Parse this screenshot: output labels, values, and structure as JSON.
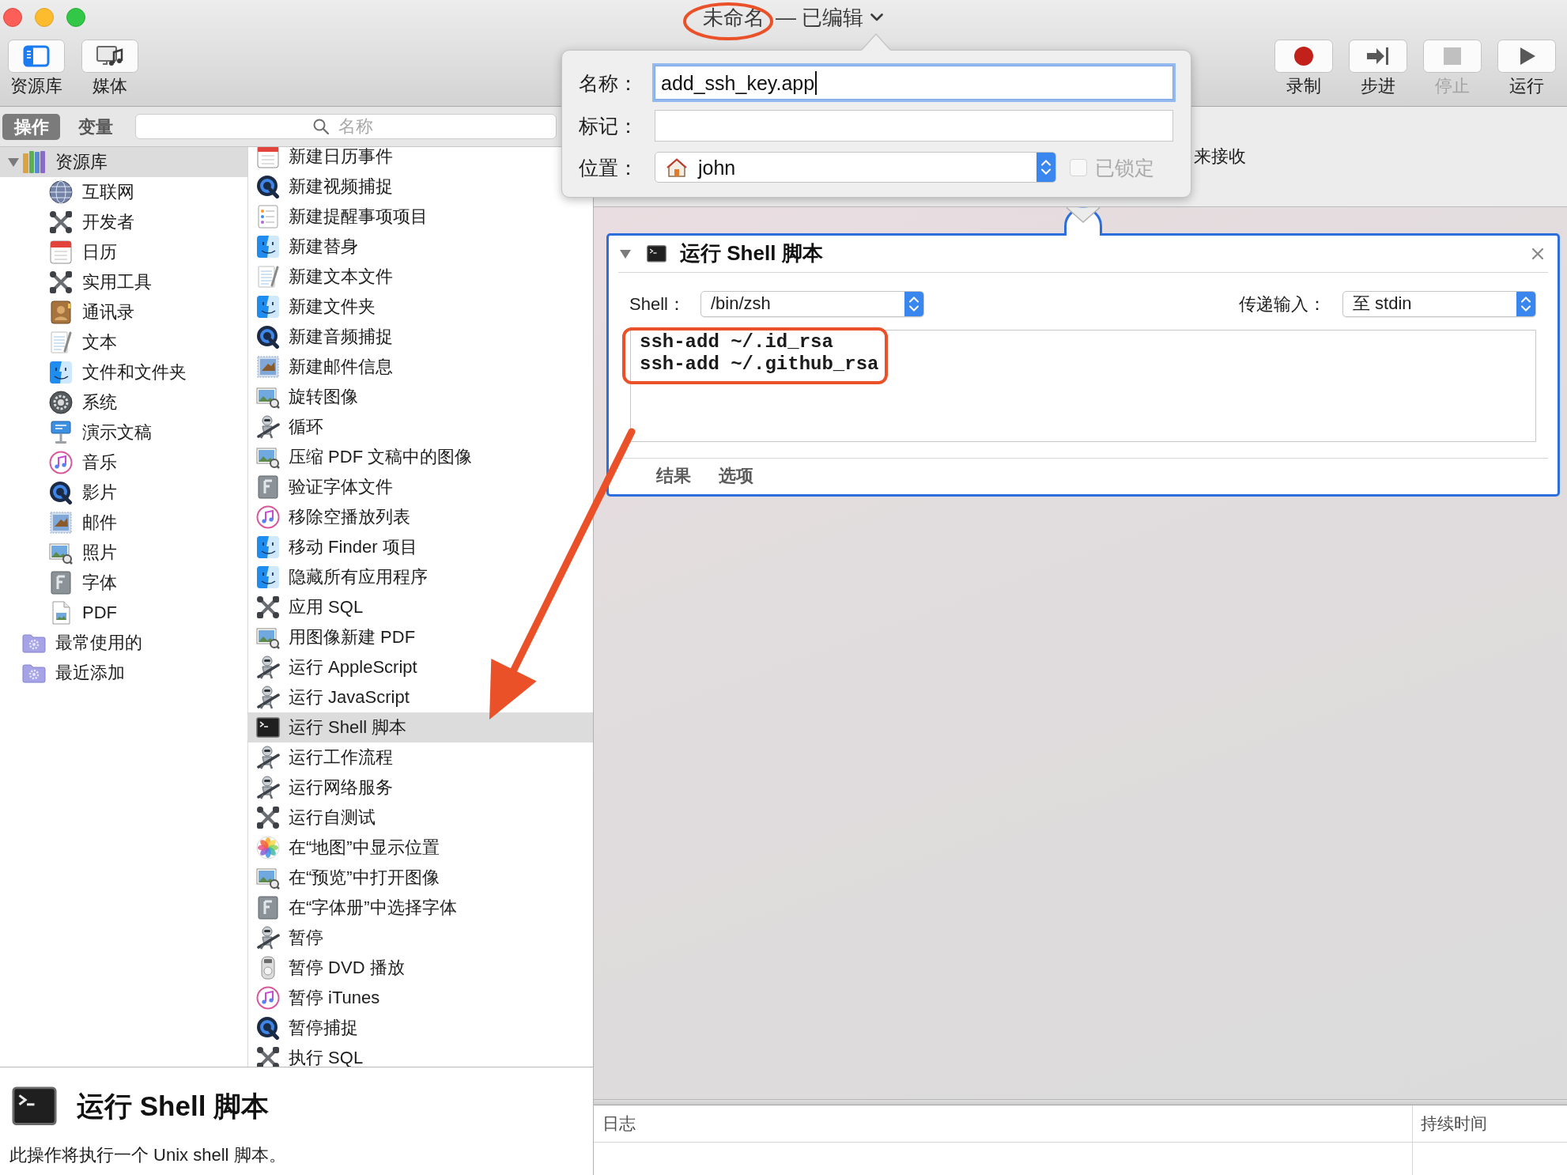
{
  "window": {
    "title": "未命名",
    "status": "— 已编辑"
  },
  "toolbar": {
    "left": [
      {
        "kind": "library",
        "label": "资源库"
      },
      {
        "kind": "media",
        "label": "媒体"
      }
    ],
    "right": [
      {
        "kind": "record",
        "label": "录制",
        "disabled": false
      },
      {
        "kind": "step",
        "label": "步进",
        "disabled": false
      },
      {
        "kind": "stop",
        "label": "停止",
        "disabled": true
      },
      {
        "kind": "run",
        "label": "运行",
        "disabled": false
      }
    ]
  },
  "library_tabs": [
    {
      "label": "操作",
      "selected": true
    },
    {
      "label": "变量",
      "selected": false
    }
  ],
  "search": {
    "placeholder": "名称"
  },
  "library_tree": [
    {
      "kind": "library",
      "label": "资源库",
      "expanded": true,
      "selected": true,
      "children": [
        {
          "kind": "globe",
          "label": "互联网",
          "selected": false
        },
        {
          "kind": "tools",
          "label": "开发者",
          "selected": false
        },
        {
          "kind": "calendar",
          "label": "日历",
          "selected": false
        },
        {
          "kind": "tools",
          "label": "实用工具",
          "selected": false
        },
        {
          "kind": "contacts",
          "label": "通讯录",
          "selected": false
        },
        {
          "kind": "text",
          "label": "文本",
          "selected": false
        },
        {
          "kind": "finder",
          "label": "文件和文件夹",
          "selected": false
        },
        {
          "kind": "system",
          "label": "系统",
          "selected": false
        },
        {
          "kind": "keynote",
          "label": "演示文稿",
          "selected": false
        },
        {
          "kind": "music",
          "label": "音乐",
          "selected": false
        },
        {
          "kind": "quicktime",
          "label": "影片",
          "selected": false
        },
        {
          "kind": "mail",
          "label": "邮件",
          "selected": false
        },
        {
          "kind": "preview",
          "label": "照片",
          "selected": false
        },
        {
          "kind": "font",
          "label": "字体",
          "selected": false
        },
        {
          "kind": "pdf",
          "label": "PDF",
          "selected": false
        }
      ]
    },
    {
      "kind": "smartfolder",
      "label": "最常使用的",
      "selected": false
    },
    {
      "kind": "smartfolder",
      "label": "最近添加",
      "selected": false
    }
  ],
  "actions": [
    {
      "kind": "calendar",
      "label": "新建日历事件",
      "selected": false
    },
    {
      "kind": "quicktime",
      "label": "新建视频捕捉",
      "selected": false
    },
    {
      "kind": "reminders",
      "label": "新建提醒事项项目",
      "selected": false
    },
    {
      "kind": "finder",
      "label": "新建替身",
      "selected": false
    },
    {
      "kind": "text",
      "label": "新建文本文件",
      "selected": false
    },
    {
      "kind": "finder",
      "label": "新建文件夹",
      "selected": false
    },
    {
      "kind": "quicktime",
      "label": "新建音频捕捉",
      "selected": false
    },
    {
      "kind": "mail",
      "label": "新建邮件信息",
      "selected": false
    },
    {
      "kind": "preview",
      "label": "旋转图像",
      "selected": false
    },
    {
      "kind": "robot",
      "label": "循环",
      "selected": false
    },
    {
      "kind": "preview",
      "label": "压缩 PDF 文稿中的图像",
      "selected": false
    },
    {
      "kind": "font",
      "label": "验证字体文件",
      "selected": false
    },
    {
      "kind": "music",
      "label": "移除空播放列表",
      "selected": false
    },
    {
      "kind": "finder",
      "label": "移动 Finder 项目",
      "selected": false
    },
    {
      "kind": "finder",
      "label": "隐藏所有应用程序",
      "selected": false
    },
    {
      "kind": "tools",
      "label": "应用 SQL",
      "selected": false
    },
    {
      "kind": "preview",
      "label": "用图像新建 PDF",
      "selected": false
    },
    {
      "kind": "robot",
      "label": "运行 AppleScript",
      "selected": false
    },
    {
      "kind": "robot",
      "label": "运行 JavaScript",
      "selected": false
    },
    {
      "kind": "terminal",
      "label": "运行 Shell 脚本",
      "selected": true
    },
    {
      "kind": "robot",
      "label": "运行工作流程",
      "selected": false
    },
    {
      "kind": "robot",
      "label": "运行网络服务",
      "selected": false
    },
    {
      "kind": "tools",
      "label": "运行自测试",
      "selected": false
    },
    {
      "kind": "photos",
      "label": "在“地图”中显示位置",
      "selected": false
    },
    {
      "kind": "preview",
      "label": "在“预览”中打开图像",
      "selected": false
    },
    {
      "kind": "font",
      "label": "在“字体册”中选择字体",
      "selected": false
    },
    {
      "kind": "robot",
      "label": "暂停",
      "selected": false
    },
    {
      "kind": "dvd",
      "label": "暂停 DVD 播放",
      "selected": false
    },
    {
      "kind": "music",
      "label": "暂停 iTunes",
      "selected": false
    },
    {
      "kind": "quicktime",
      "label": "暂停捕捉",
      "selected": false
    },
    {
      "kind": "tools",
      "label": "执行 SQL",
      "selected": false
    }
  ],
  "description": {
    "kind": "terminal",
    "title": "运行 Shell 脚本",
    "text": "此操作将执行一个 Unix shell 脚本。"
  },
  "workflow": {
    "header_text": "来接收",
    "action_card": {
      "kind": "terminal",
      "title": "运行 Shell 脚本",
      "expanded": true,
      "selected": true,
      "shell_label": "Shell：",
      "shell_value": "/bin/zsh",
      "input_label": "传递输入：",
      "input_value": "至 stdin",
      "script": [
        "ssh-add ~/.id_rsa",
        "ssh-add ~/.github_rsa"
      ],
      "tabs": [
        {
          "label": "结果",
          "selected": false
        },
        {
          "label": "选项",
          "selected": false
        }
      ]
    }
  },
  "log": {
    "columns": [
      "日志",
      "持续时间"
    ]
  },
  "save_popover": {
    "fields": [
      {
        "kind": "text",
        "label": "名称：",
        "value": "add_ssh_key.app",
        "focused": true
      },
      {
        "kind": "tags",
        "label": "标记：",
        "focused": false
      },
      {
        "kind": "location",
        "label": "位置：",
        "value": "john",
        "focused": false
      }
    ],
    "lock": {
      "label": "已锁定",
      "checked": false,
      "disabled": true
    }
  },
  "annotations": [
    {
      "kind": "ellipse"
    },
    {
      "kind": "frame"
    },
    {
      "kind": "arrow"
    }
  ]
}
